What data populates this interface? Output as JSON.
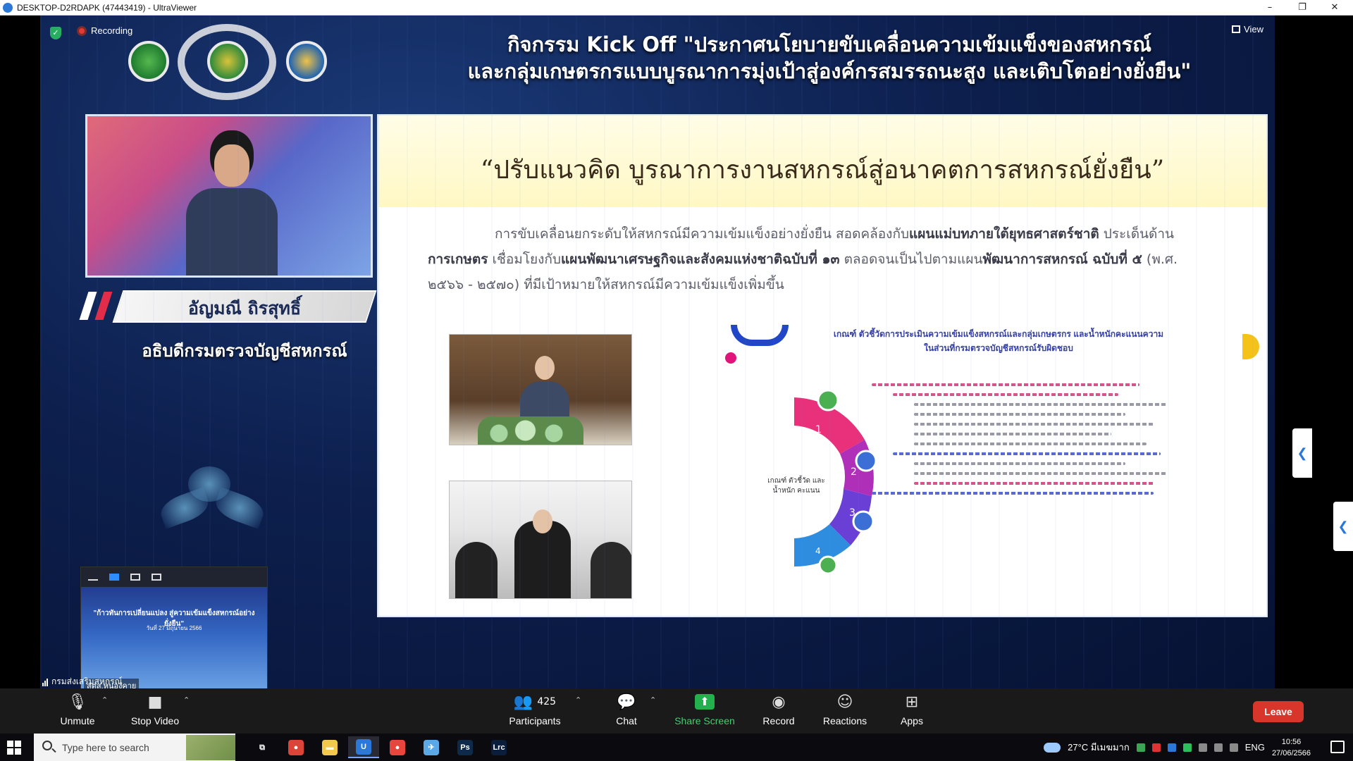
{
  "window": {
    "title": "DESKTOP-D2RDAPK (47443419) - UltraViewer",
    "minimize": "–",
    "restore": "❐",
    "close": "✕"
  },
  "meeting": {
    "recording_label": "Recording",
    "view_label": "View",
    "banner_line1": "กิจกรรม Kick Off \"ประกาศนโยบายขับเคลื่อนความเข้มแข็งของสหกรณ์",
    "banner_line2": "และกลุ่มเกษตรกรแบบบูรณาการมุ่งเป้าสู่องค์กรสมรรถนะสูง และเติบโตอย่างยั่งยืน\"",
    "speaker_name": "อัญมณี ถิรสุทธิ์",
    "speaker_role": "อธิบดีกรมตรวจบัญชีสหกรณ์",
    "self_view_name": "สตส.หนองคาย",
    "self_view_title": "\"ก้าวทันการเปลี่ยนแปลง สู่ความเข้มแข็งสหกรณ์อย่างยั่งยืน\"",
    "self_view_date": "วันที่ 27 มิถุนายน 2566",
    "network_label": "กรมส่งเสริมสหกรณ์"
  },
  "slide": {
    "title": "“ปรับแนวคิด บูรณาการงานสหกรณ์สู่อนาคตการสหกรณ์ยั่งยืน”",
    "para_part1": "การขับเคลื่อนยกระดับให้สหกรณ์มีความเข้มแข็งอย่างยั่งยืน สอดคล้องกับ",
    "para_bold1": "แผนแม่บทภายใต้ยุทธศาสตร์ชาติ",
    "para_part2": " ประเด็นด้าน",
    "para_bold2": "การเกษตร",
    "para_part3": " เชื่อมโยงกับ",
    "para_bold3": "แผนพัฒนาเศรษฐกิจและสังคมแห่งชาติฉบับที่ ๑๓",
    "para_part4": " ตลอดจนเป็นไปตามแผน",
    "para_bold4": "พัฒนาการสหกรณ์ ฉบับที่ ๕",
    "para_part5": " (พ.ศ. ๒๕๖๖ - ๒๕๗๐) ที่มีเป้าหมายให้สหกรณ์มีความเข้มแข็งเพิ่มขึ้น",
    "diagram_title": "เกณฑ์ ตัวชี้วัดการประเมินความเข้มแข็งสหกรณ์และกลุ่มเกษตรกร และน้ำหนักคะแนนความในส่วนที่กรมตรวจบัญชีสหกรณ์รับผิดชอบ",
    "diagram_center": "เกณฑ์ ตัวชี้วัด และน้ำหนัก คะแนน",
    "ring_steps": [
      "1",
      "2",
      "3",
      "4"
    ]
  },
  "toolbar": {
    "unmute": "Unmute",
    "stop_video": "Stop Video",
    "participants": "Participants",
    "participants_count": "425",
    "chat": "Chat",
    "share_screen": "Share Screen",
    "record": "Record",
    "reactions": "Reactions",
    "apps": "Apps",
    "leave": "Leave"
  },
  "taskbar": {
    "search_placeholder": "Type here to search",
    "weather": "27°C มีเมฆมาก",
    "language": "ENG",
    "time": "10:56",
    "date": "27/06/2566",
    "apps": [
      {
        "name": "task-view",
        "glyph": "⧉",
        "color": "#0b0b0f"
      },
      {
        "name": "chrome",
        "glyph": "●",
        "color": "#db4437"
      },
      {
        "name": "file-explorer",
        "glyph": "▬",
        "color": "#f2c94c"
      },
      {
        "name": "ultraviewer",
        "glyph": "U",
        "color": "#2b78d8"
      },
      {
        "name": "chrome-profile",
        "glyph": "●",
        "color": "#e8453c"
      },
      {
        "name": "app-parrot",
        "glyph": "✈",
        "color": "#5aa9e6"
      },
      {
        "name": "photoshop",
        "glyph": "Ps",
        "color": "#0d2a4a"
      },
      {
        "name": "lightroom-classic",
        "glyph": "Lrc",
        "color": "#0a1d3a"
      }
    ]
  },
  "colors": {
    "zoom_green": "#22b14c",
    "leave_red": "#d9362b",
    "stage_blue": "#0d1f4d"
  }
}
